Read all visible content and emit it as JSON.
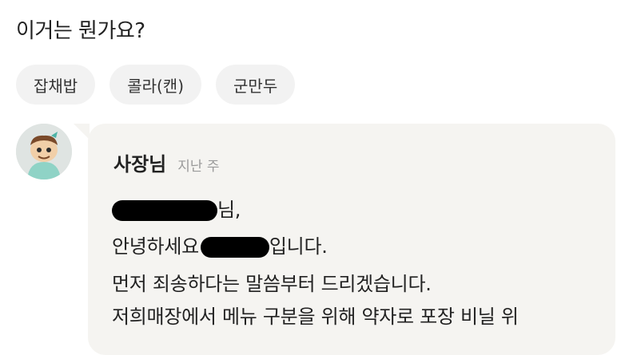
{
  "question": "이거는 뭔가요?",
  "menu_tags": [
    "잡채밥",
    "콜라(캔)",
    "군만두"
  ],
  "reply": {
    "author": "사장님",
    "time": "지난 주",
    "line1_suffix": "님,",
    "line2_prefix": "안녕하세요",
    "line2_suffix": "입니다.",
    "line3": "먼저 죄송하다는 말씀부터 드리겠습니다.",
    "line4": "저희매장에서 메뉴 구분을 위해 약자로 포장 비닐 위"
  }
}
